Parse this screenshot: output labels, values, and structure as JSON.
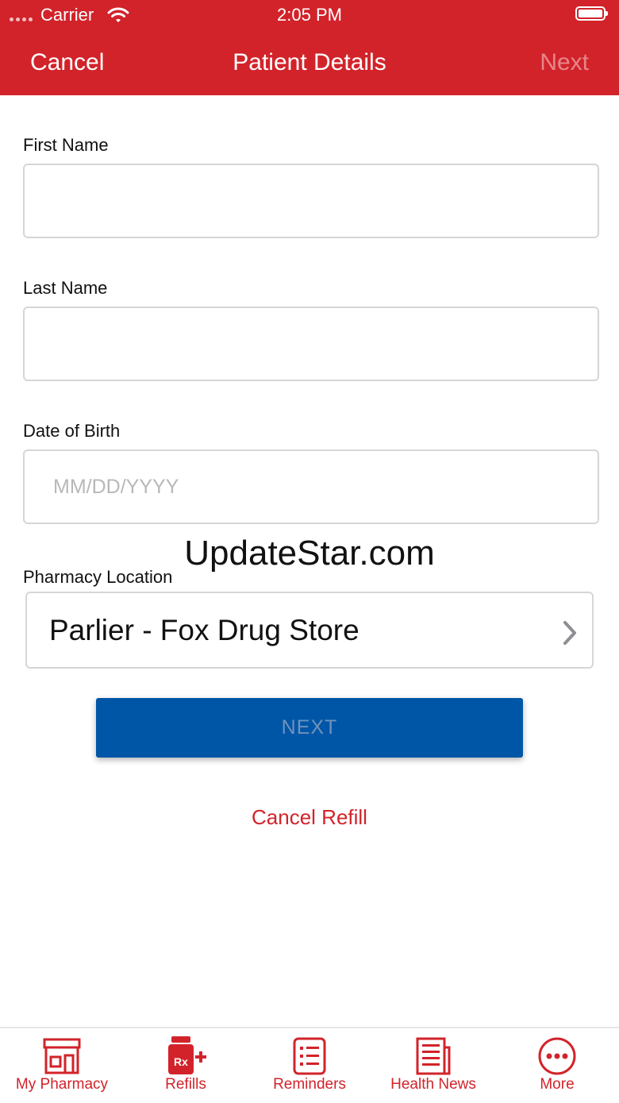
{
  "status_bar": {
    "carrier": "Carrier",
    "time": "2:05 PM"
  },
  "nav": {
    "cancel_label": "Cancel",
    "title": "Patient Details",
    "next_label": "Next"
  },
  "form": {
    "first_name": {
      "label": "First Name",
      "value": "",
      "placeholder": ""
    },
    "last_name": {
      "label": "Last Name",
      "value": "",
      "placeholder": ""
    },
    "dob": {
      "label": "Date of Birth",
      "value": "",
      "placeholder": "MM/DD/YYYY"
    },
    "pharmacy": {
      "label": "Pharmacy Location",
      "value": "Parlier - Fox Drug Store"
    }
  },
  "watermark": "UpdateStar.com",
  "next_button_label": "NEXT",
  "cancel_refill_label": "Cancel Refill",
  "tabs": [
    {
      "label": "My Pharmacy",
      "icon": "store-icon"
    },
    {
      "label": "Refills",
      "icon": "rx-bottle-icon"
    },
    {
      "label": "Reminders",
      "icon": "checklist-icon"
    },
    {
      "label": "Health News",
      "icon": "newspaper-icon"
    },
    {
      "label": "More",
      "icon": "more-dots-icon"
    }
  ],
  "colors": {
    "brand_red": "#d2232a",
    "button_blue": "#0056a6"
  }
}
